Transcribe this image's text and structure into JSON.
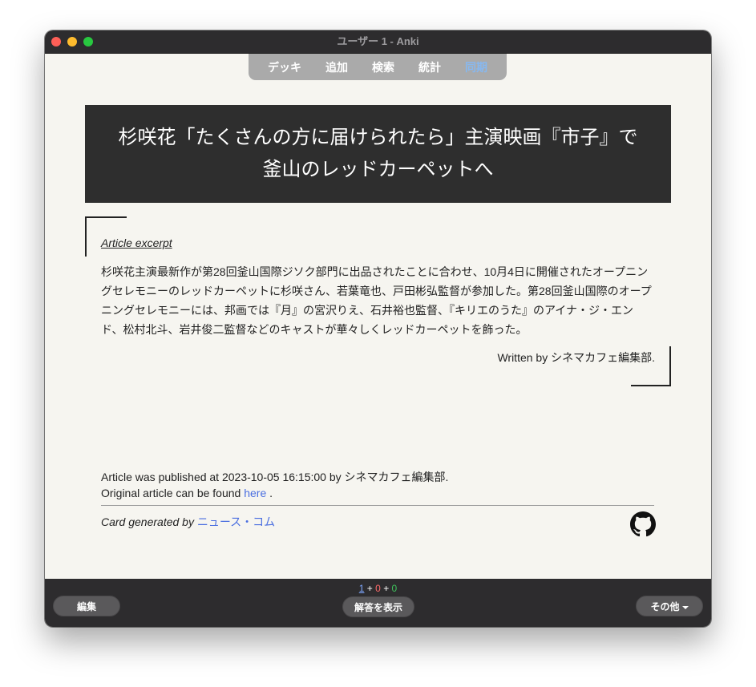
{
  "window": {
    "title": "ユーザー 1 - Anki"
  },
  "toolbar": {
    "items": [
      {
        "label": "デッキ"
      },
      {
        "label": "追加"
      },
      {
        "label": "検索"
      },
      {
        "label": "統計"
      },
      {
        "label": "同期"
      }
    ]
  },
  "card": {
    "headline": "杉咲花「たくさんの方に届けられたら」主演映画『市子』で釜山のレッドカーペットへ",
    "excerpt_label": "Article excerpt",
    "body": "杉咲花主演最新作が第28回釜山国際ジソク部門に出品されたことに合わせ、10月4日に開催されたオープニングセレモニーのレッドカーペットに杉咲さん、若葉竜也、戸田彬弘監督が参加した。第28回釜山国際のオープニングセレモニーには、邦画では『月』の宮沢りえ、石井裕也監督、『キリエのうた』のアイナ・ジ・エンド、松村北斗、岩井俊二監督などのキャストが華々しくレッドカーペットを飾った。",
    "written_by": "Written by シネマカフェ編集部.",
    "published_text": "Article was published at 2023-10-05 16:15:00 by シネマカフェ編集部.",
    "original_prefix": "Original article can be found",
    "original_link": "here",
    "original_suffix": ".",
    "generated_prefix": "Card generated by",
    "generated_link": "ニュース・コム",
    "github_icon": "github-icon"
  },
  "bottombar": {
    "count_new": "1",
    "count_learn": "0",
    "count_review": "0",
    "plus": "+",
    "edit_label": "編集",
    "show_answer_label": "解答を表示",
    "more_label": "その他"
  }
}
